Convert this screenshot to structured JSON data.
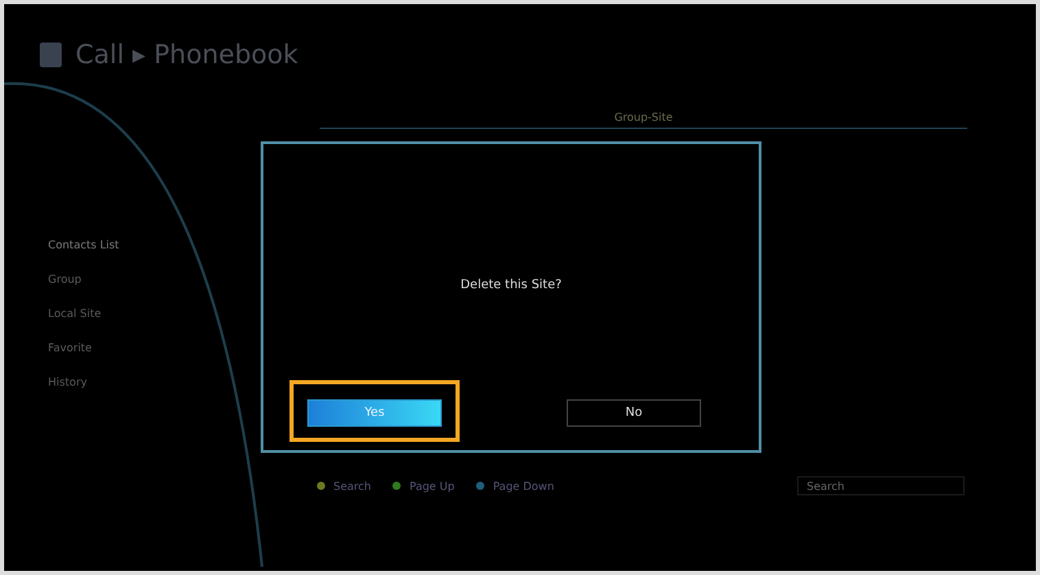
{
  "header": {
    "title": "Call ▸ Phonebook"
  },
  "sidebar": {
    "items": [
      {
        "label": "Contacts List",
        "selected": true
      },
      {
        "label": "Group",
        "selected": false
      },
      {
        "label": "Local Site",
        "selected": false
      },
      {
        "label": "Favorite",
        "selected": false
      },
      {
        "label": "History",
        "selected": false
      }
    ]
  },
  "tab": {
    "label": "Group-Site"
  },
  "legend": [
    {
      "label": "Search",
      "color": "#6b7a1e"
    },
    {
      "label": "Page Up",
      "color": "#2f7a1e"
    },
    {
      "label": "Page Down",
      "color": "#1e5f7a"
    }
  ],
  "search": {
    "placeholder": "Search"
  },
  "dialog": {
    "message": "Delete this Site?",
    "buttons": [
      {
        "label": "Yes",
        "selected": true
      },
      {
        "label": "No",
        "selected": false
      }
    ]
  }
}
